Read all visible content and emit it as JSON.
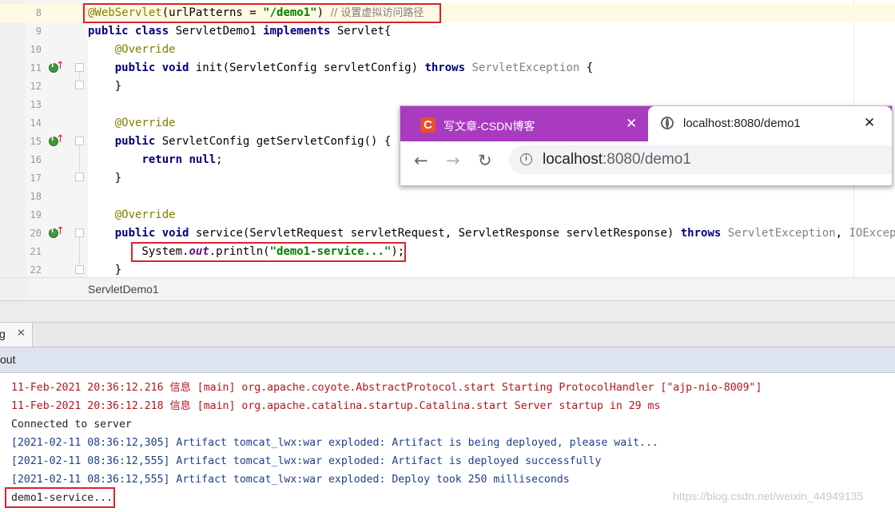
{
  "editor": {
    "lines": [
      {
        "n": "8",
        "parts": [
          [
            "ann",
            "@WebServlet"
          ],
          [
            "",
            "(urlPatterns = "
          ],
          [
            "str",
            "\"/demo1\""
          ],
          [
            "",
            ") "
          ],
          [
            "cmt",
            "// 设置虚拟访问路径"
          ]
        ]
      },
      {
        "n": "9",
        "parts": [
          [
            "kw",
            "public class "
          ],
          [
            "",
            "ServletDemo1 "
          ],
          [
            "kw",
            "implements "
          ],
          [
            "",
            "Servlet{"
          ]
        ]
      },
      {
        "n": "10",
        "parts": [
          [
            "",
            "    "
          ],
          [
            "ann",
            "@Override"
          ]
        ]
      },
      {
        "n": "11",
        "parts": [
          [
            "",
            "    "
          ],
          [
            "kw",
            "public void "
          ],
          [
            "",
            "init(ServletConfig servletConfig) "
          ],
          [
            "kw",
            "throws "
          ],
          [
            "gray",
            "ServletException "
          ],
          [
            "",
            "{"
          ]
        ]
      },
      {
        "n": "12",
        "parts": [
          [
            "",
            "    }"
          ]
        ]
      },
      {
        "n": "13",
        "parts": []
      },
      {
        "n": "14",
        "parts": [
          [
            "",
            "    "
          ],
          [
            "ann",
            "@Override"
          ]
        ]
      },
      {
        "n": "15",
        "parts": [
          [
            "",
            "    "
          ],
          [
            "kw",
            "public "
          ],
          [
            "",
            "ServletConfig getServletConfig() {"
          ]
        ]
      },
      {
        "n": "16",
        "parts": [
          [
            "",
            "        "
          ],
          [
            "kw",
            "return null"
          ],
          [
            "",
            ";"
          ]
        ]
      },
      {
        "n": "17",
        "parts": [
          [
            "",
            "    }"
          ]
        ]
      },
      {
        "n": "18",
        "parts": []
      },
      {
        "n": "19",
        "parts": [
          [
            "",
            "    "
          ],
          [
            "ann",
            "@Override"
          ]
        ]
      },
      {
        "n": "20",
        "parts": [
          [
            "",
            "    "
          ],
          [
            "kw",
            "public void "
          ],
          [
            "",
            "service(ServletRequest servletRequest, ServletResponse servletResponse) "
          ],
          [
            "kw",
            "throws "
          ],
          [
            "gray",
            "ServletException"
          ],
          [
            "",
            ", "
          ],
          [
            "gray",
            "IOException"
          ]
        ]
      },
      {
        "n": "21",
        "parts": [
          [
            "",
            "        System."
          ],
          [
            "field",
            "out"
          ],
          [
            "",
            ".println("
          ],
          [
            "str",
            "\"demo1-service...\""
          ],
          [
            "",
            ");"
          ]
        ]
      },
      {
        "n": "22",
        "parts": [
          [
            "",
            "    }"
          ]
        ]
      }
    ],
    "breadcrumb": "ServletDemo1"
  },
  "run_panel": {
    "tab_label": "g",
    "tab_close": "✕",
    "output_label": "out"
  },
  "console": {
    "lines": [
      {
        "color": "c-red",
        "text": "11-Feb-2021 20:36:12.216 信息 [main] org.apache.coyote.AbstractProtocol.start Starting ProtocolHandler [\"ajp-nio-8009\"]"
      },
      {
        "color": "c-red",
        "text": "11-Feb-2021 20:36:12.218 信息 [main] org.apache.catalina.startup.Catalina.start Server startup in 29 ms"
      },
      {
        "color": "c-blk",
        "text": "Connected to server"
      },
      {
        "color": "c-blue",
        "text": "[2021-02-11 08:36:12,305] Artifact tomcat_lwx:war exploded: Artifact is being deployed, please wait..."
      },
      {
        "color": "c-blue",
        "text": "[2021-02-11 08:36:12,555] Artifact tomcat_lwx:war exploded: Artifact is deployed successfully"
      },
      {
        "color": "c-blue",
        "text": "[2021-02-11 08:36:12,555] Artifact tomcat_lwx:war exploded: Deploy took 250 milliseconds"
      },
      {
        "color": "c-blk",
        "text": "demo1-service..."
      }
    ],
    "watermark": "https://blog.csdn.net/weixin_44949135"
  },
  "browser": {
    "tabs": [
      {
        "favicon": "C",
        "title": "写文章-CSDN博客",
        "close": "✕"
      },
      {
        "icon": "globe-icon",
        "title": "localhost:8080/demo1",
        "close": "✕"
      }
    ],
    "nav": {
      "back": "←",
      "forward": "→",
      "reload": "↻"
    },
    "url_host": "localhost",
    "url_rest": ":8080/demo1",
    "colors": {
      "tabstrip": "#a93bc0",
      "csdn": "#e8502e"
    }
  }
}
